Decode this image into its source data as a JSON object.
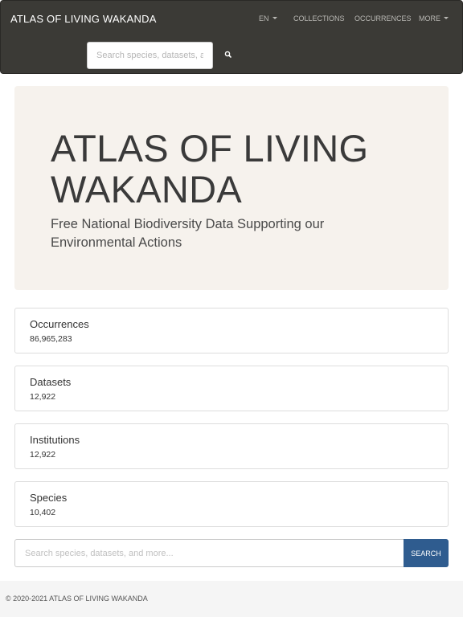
{
  "navbar": {
    "brand": "ATLAS OF LIVING WAKANDA",
    "items": [
      {
        "label": "EN",
        "dropdown": true
      },
      {
        "label": "COLLECTIONS",
        "dropdown": false
      },
      {
        "label": "OCCURRENCES",
        "dropdown": false
      },
      {
        "label": "MORE",
        "dropdown": true
      }
    ],
    "search": {
      "placeholder": "Search species, datasets, and more...",
      "icon": "search-icon"
    }
  },
  "hero": {
    "title": "ATLAS OF LIVING WAKANDA",
    "subtitle": "Free National Biodiversity Data Supporting our Environmental Actions"
  },
  "stats": [
    {
      "label": "Occurrences",
      "value": "86,965,283"
    },
    {
      "label": "Datasets",
      "value": "12,922"
    },
    {
      "label": "Institutions",
      "value": "12,922"
    },
    {
      "label": "Species",
      "value": "10,402"
    }
  ],
  "search": {
    "placeholder": "Search species, datasets, and more...",
    "button_label": "SEARCH"
  },
  "footer": {
    "text": "© 2020-2021 ATLAS OF LIVING WAKANDA"
  },
  "colors": {
    "navbar_bg": "#3b3a36",
    "jumbotron_bg": "#f6f2ed",
    "search_button": "#2f5c8f",
    "footer_bg": "#f5f5f5"
  }
}
